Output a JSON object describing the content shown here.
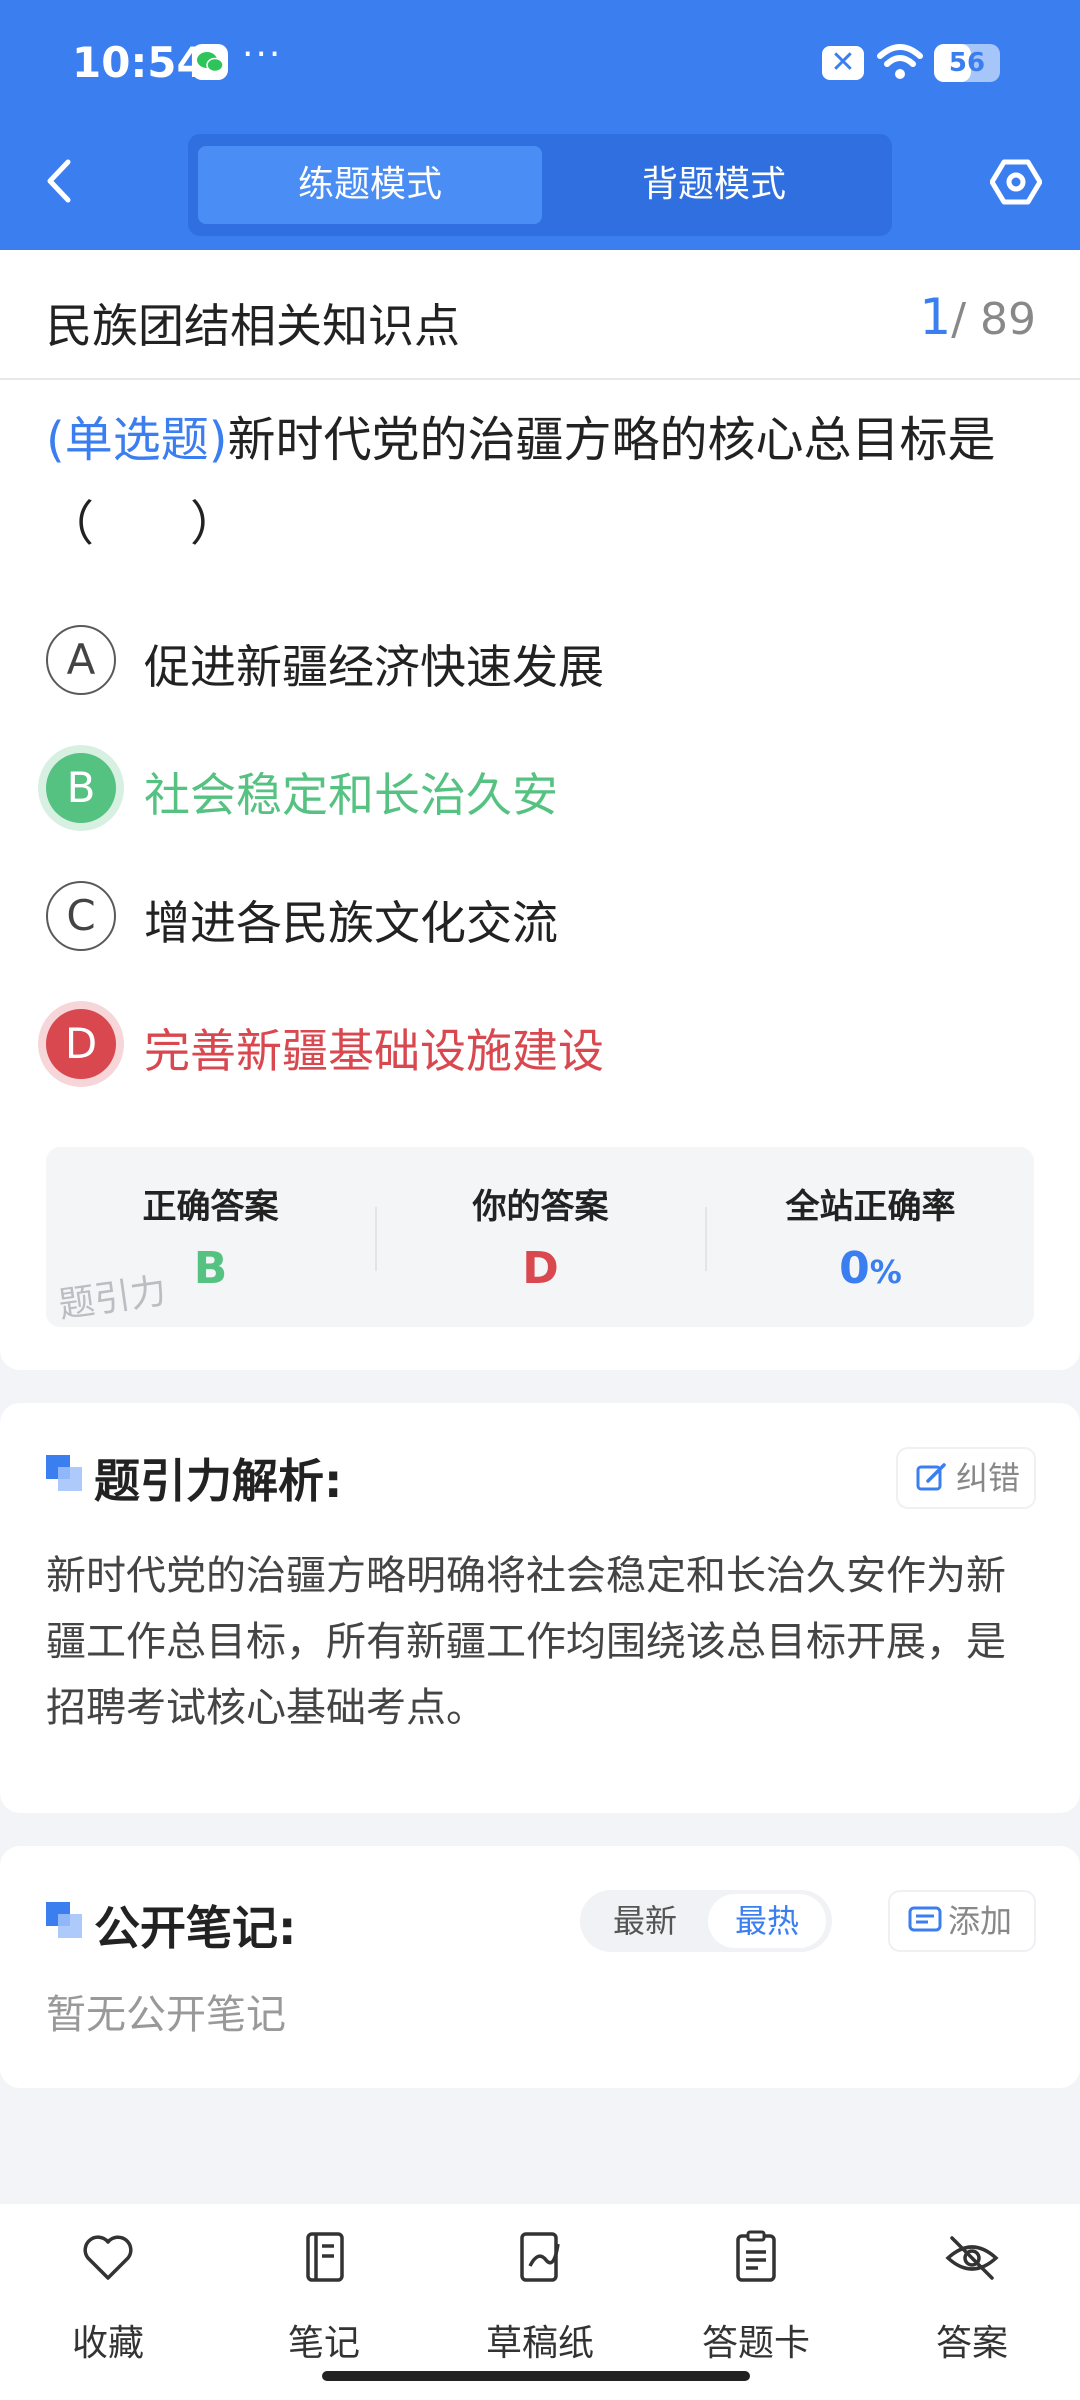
{
  "status_bar": {
    "time": "10:54",
    "battery_level": "56",
    "battery_fraction": 0.56
  },
  "header": {
    "tabs": [
      {
        "label": "练题模式",
        "active": true
      },
      {
        "label": "背题模式",
        "active": false
      }
    ]
  },
  "topic": {
    "title": "民族团结相关知识点",
    "current": "1",
    "total": "/ 89"
  },
  "question": {
    "type": "(单选题)",
    "text": "新时代党的治疆方略的核心总目标是（　　）"
  },
  "options": [
    {
      "letter": "A",
      "text": "促进新疆经济快速发展",
      "state": "normal"
    },
    {
      "letter": "B",
      "text": "社会稳定和长治久安",
      "state": "correct"
    },
    {
      "letter": "C",
      "text": "增进各民族文化交流",
      "state": "normal"
    },
    {
      "letter": "D",
      "text": "完善新疆基础设施建设",
      "state": "wrong"
    }
  ],
  "answer_summary": {
    "correct_label": "正确答案",
    "correct_value": "B",
    "yours_label": "你的答案",
    "yours_value": "D",
    "rate_label": "全站正确率",
    "rate_value": "0",
    "rate_unit": "%",
    "watermark": "题引力"
  },
  "analysis": {
    "title": "题引力解析:",
    "report_label": "纠错",
    "text": "新时代党的治疆方略明确将社会稳定和长治久安作为新疆工作总目标，所有新疆工作均围绕该总目标开展，是招聘考试核心基础考点。"
  },
  "notes": {
    "title": "公开笔记:",
    "sort_latest": "最新",
    "sort_hot": "最热",
    "add_label": "添加",
    "empty_text": "暂无公开笔记"
  },
  "tabbar": [
    {
      "label": "收藏",
      "icon": "heart-icon"
    },
    {
      "label": "笔记",
      "icon": "notebook-icon"
    },
    {
      "label": "草稿纸",
      "icon": "draft-icon"
    },
    {
      "label": "答题卡",
      "icon": "answer-card-icon"
    },
    {
      "label": "答案",
      "icon": "eye-off-icon"
    }
  ],
  "colors": {
    "primary": "#3b7ef0",
    "correct": "#55c281",
    "wrong": "#d9474f"
  }
}
